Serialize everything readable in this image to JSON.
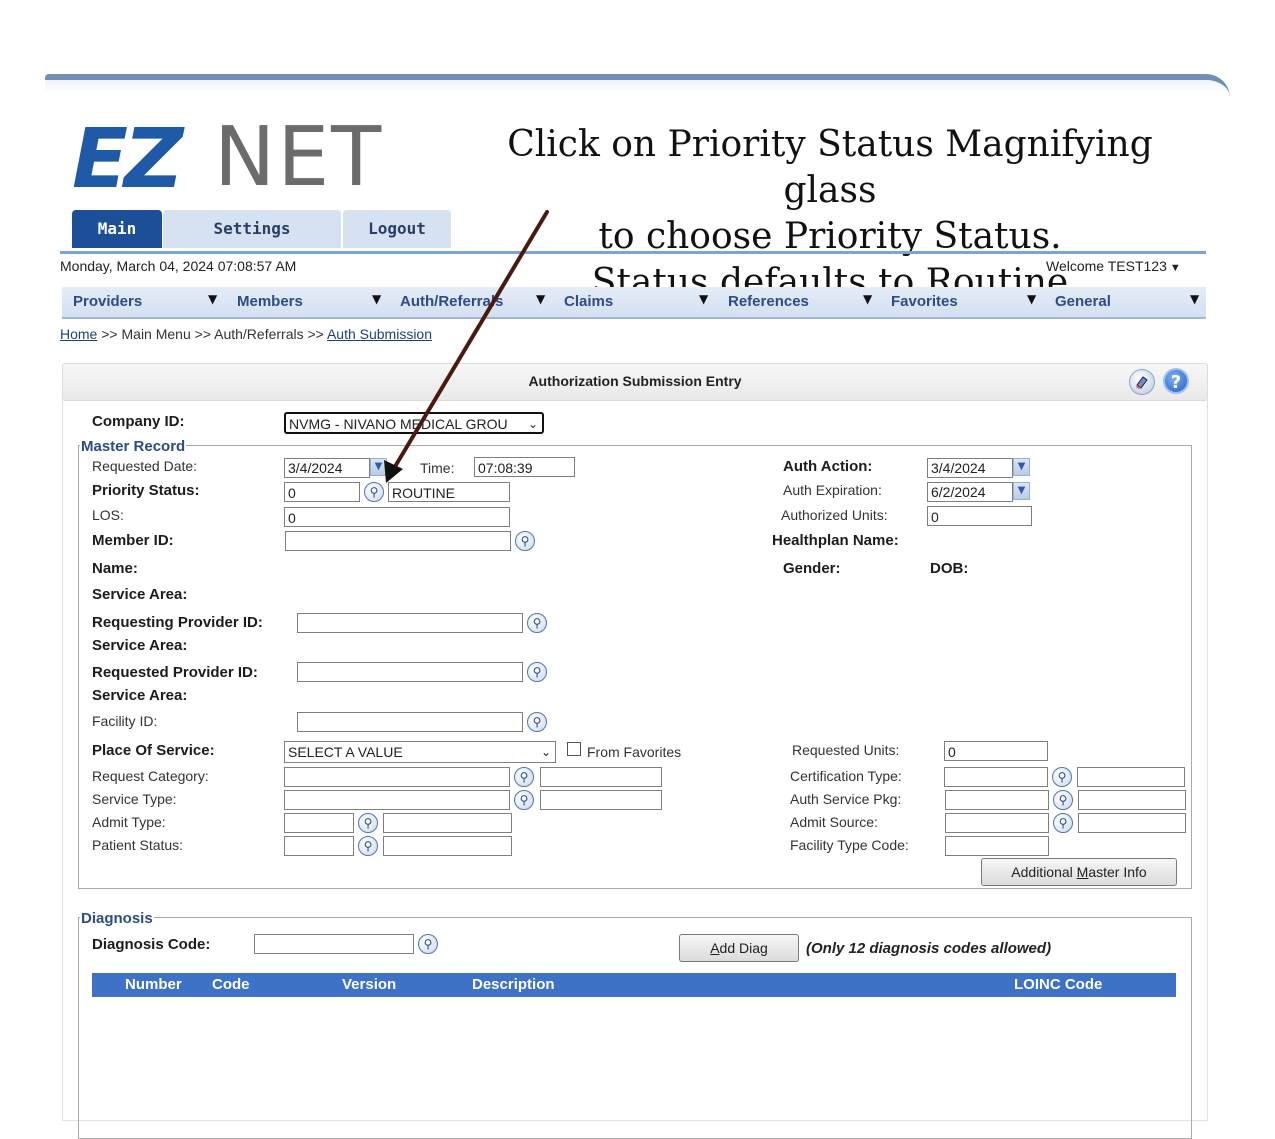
{
  "logo": {
    "ez": "EZ",
    "net": "NET"
  },
  "annotation": {
    "line1": "Click on Priority Status Magnifying glass",
    "line2": "to choose Priority Status.",
    "line3": "Status defaults to Routine"
  },
  "tabs": {
    "main": "Main",
    "settings": "Settings",
    "logout": "Logout"
  },
  "header": {
    "date": "Monday, March 04, 2024 07:08:57 AM",
    "welcome": "Welcome TEST123"
  },
  "menu": [
    "Providers",
    "Members",
    "Auth/Referrals",
    "Claims",
    "References",
    "Favorites",
    "General"
  ],
  "breadcrumb": {
    "home": "Home",
    "sep1": " >> Main Menu >> Auth/Referrals >> ",
    "current": "Auth Submission"
  },
  "page_title": "Authorization Submission Entry",
  "company": {
    "label": "Company ID:",
    "value": "NVMG - NIVANO MEDICAL GROU"
  },
  "master_record": {
    "legend": "Master Record",
    "requested_date_label": "Requested Date:",
    "requested_date": "3/4/2024",
    "time_label": "Time:",
    "time": "07:08:39",
    "priority_label": "Priority Status:",
    "priority_code": "0",
    "priority_text": "ROUTINE",
    "los_label": "LOS:",
    "los": "0",
    "member_id_label": "Member ID:",
    "member_id": "",
    "name_label": "Name:",
    "service_area_label": "Service Area:",
    "req_provider_label": "Requesting Provider ID:",
    "req_provider_area_label": "Service Area:",
    "requested_provider_label": "Requested Provider ID:",
    "requested_provider_area_label": "Service Area:",
    "facility_label": "Facility ID:",
    "pos_label": "Place Of Service:",
    "pos_value": "SELECT A VALUE",
    "from_favorites": "From Favorites",
    "request_category_label": "Request Category:",
    "service_type_label": "Service Type:",
    "admit_type_label": "Admit Type:",
    "patient_status_label": "Patient Status:",
    "auth_action_label": "Auth Action:",
    "auth_action": "3/4/2024",
    "auth_expiration_label": "Auth Expiration:",
    "auth_expiration": "6/2/2024",
    "authorized_units_label": "Authorized Units:",
    "authorized_units": "0",
    "healthplan_label": "Healthplan Name:",
    "gender_label": "Gender:",
    "dob_label": "DOB:",
    "requested_units_label": "Requested Units:",
    "requested_units": "0",
    "certification_type_label": "Certification Type:",
    "auth_service_pkg_label": "Auth Service Pkg:",
    "admit_source_label": "Admit Source:",
    "facility_type_label": "Facility Type Code:",
    "additional_btn_pre": "Additional ",
    "additional_btn_u": "M",
    "additional_btn_post": "aster Info"
  },
  "diagnosis": {
    "legend": "Diagnosis",
    "code_label": "Diagnosis Code:",
    "add_btn_u": "A",
    "add_btn_post": "dd Diag",
    "note": "(Only 12 diagnosis codes allowed)",
    "columns": [
      "Number",
      "Code",
      "Version",
      "Description",
      "LOINC Code"
    ]
  },
  "colors": {
    "accent": "#1d4f99",
    "grid_header": "#3d72c6",
    "arrow": "#4a1a0e"
  }
}
